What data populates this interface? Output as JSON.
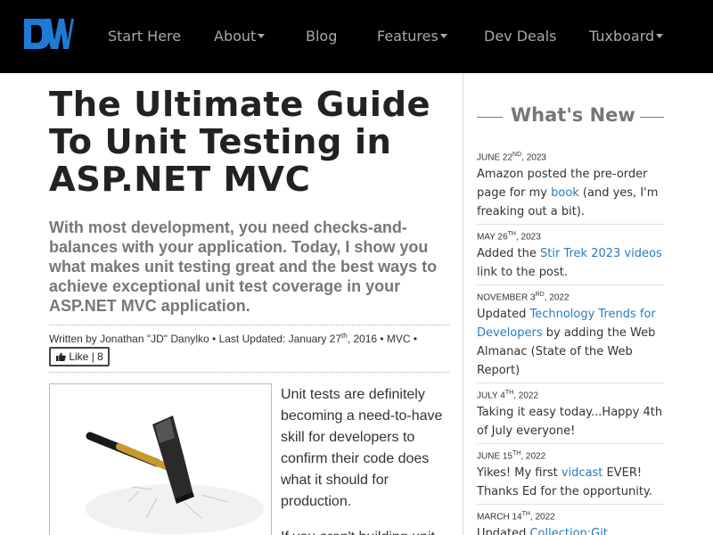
{
  "nav": {
    "logo_text": "DW",
    "items": [
      {
        "label": "Start Here",
        "dropdown": false
      },
      {
        "label": "About",
        "dropdown": true
      },
      {
        "label": "Blog",
        "dropdown": false
      },
      {
        "label": "Features",
        "dropdown": true
      },
      {
        "label": "Dev Deals",
        "dropdown": false
      },
      {
        "label": "Tuxboard",
        "dropdown": true
      }
    ]
  },
  "article": {
    "title": "The Ultimate Guide To Unit Testing in ASP.NET MVC",
    "subtitle": "With most development, you need checks-and-balances with your application. Today, I show you what makes unit testing great and the best ways to achieve exceptional unit test coverage in your ASP.NET MVC application.",
    "meta": {
      "written_by": "Written by Jonathan \"JD\" Danylko • Last Updated: January 27",
      "date_suffix": "th",
      "tail": ", 2016 • MVC •"
    },
    "like_label": "Like | 8",
    "body_p1": "Unit tests are definitely becoming a need-to-have skill for developers to confirm their code does what it should for production.",
    "body_p2": "If you aren't building unit"
  },
  "sidebar": {
    "heading": "What's New",
    "news": [
      {
        "date": "JUNE 22",
        "suffix": "ND",
        "year": ", 2023",
        "before": "Amazon posted the pre-order page for my ",
        "link": "book",
        "after": " (and yes, I'm freaking out a bit)."
      },
      {
        "date": "MAY 26",
        "suffix": "TH",
        "year": ", 2023",
        "before": "Added the ",
        "link": "Stir Trek 2023 videos",
        "after": " link to the post."
      },
      {
        "date": "NOVEMBER 3",
        "suffix": "RD",
        "year": ", 2022",
        "before": "Updated ",
        "link": "Technology Trends for Developers",
        "after": " by adding the Web Almanac (State of the Web Report)"
      },
      {
        "date": "JULY 4",
        "suffix": "TH",
        "year": ", 2022",
        "before": "Taking it easy today...Happy 4th of July everyone!",
        "link": "",
        "after": ""
      },
      {
        "date": "JUNE 15",
        "suffix": "TH",
        "year": ", 2022",
        "before": "Yikes! My first ",
        "link": "vidcast",
        "after": " EVER! Thanks Ed for the opportunity."
      },
      {
        "date": "MARCH 14",
        "suffix": "TH",
        "year": ", 2022",
        "before": "Updated ",
        "link": "Collection:Git Resources",
        "after": ""
      }
    ]
  },
  "colors": {
    "nav_bg": "#000000",
    "nav_text": "#a8a8a8",
    "logo_blue": "#1e7ad6",
    "link": "#2a7bc2",
    "heading_gray": "#777777"
  },
  "icons": {
    "like": "thumbs-up-icon",
    "caret": "caret-down-icon",
    "logo": "dw-logo",
    "article_image": "hammer-image"
  }
}
